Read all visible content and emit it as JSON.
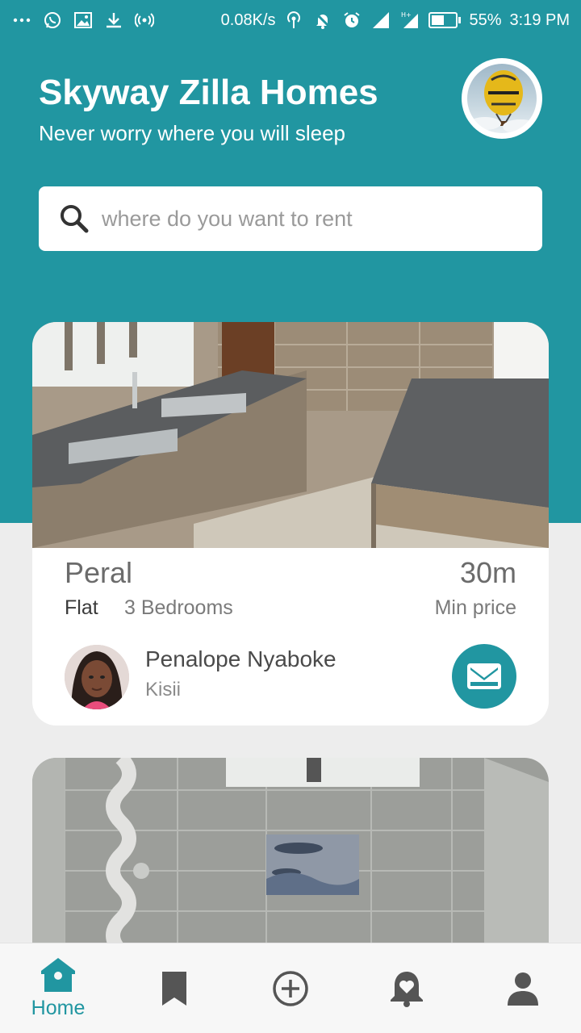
{
  "status_bar": {
    "network_speed": "0.08K/s",
    "battery": "55%",
    "battery_level": 0.55,
    "time": "3:19 PM",
    "network_label": "H+"
  },
  "header": {
    "title": "Skyway Zilla Homes",
    "subtitle": "Never worry where you will sleep",
    "avatar_icon": "hot-air-balloon-avatar"
  },
  "search": {
    "placeholder": "where do you want to rent",
    "value": ""
  },
  "listings": [
    {
      "name": "Peral",
      "type": "Flat",
      "bedrooms": "3 Bedrooms",
      "price": "30m",
      "price_label": "Min price",
      "owner_name": "Penalope Nyaboke",
      "owner_location": "Kisii",
      "photo": "kitchen-photo"
    },
    {
      "photo": "bathroom-photo"
    }
  ],
  "bottom_nav": {
    "items": [
      {
        "icon": "home-icon",
        "label": "Home",
        "active": true
      },
      {
        "icon": "bookmark-icon",
        "label": ""
      },
      {
        "icon": "add-circle-icon",
        "label": ""
      },
      {
        "icon": "notification-heart-icon",
        "label": ""
      },
      {
        "icon": "profile-icon",
        "label": ""
      }
    ]
  },
  "colors": {
    "primary": "#2196a1",
    "background": "#ededed",
    "card": "#ffffff"
  }
}
